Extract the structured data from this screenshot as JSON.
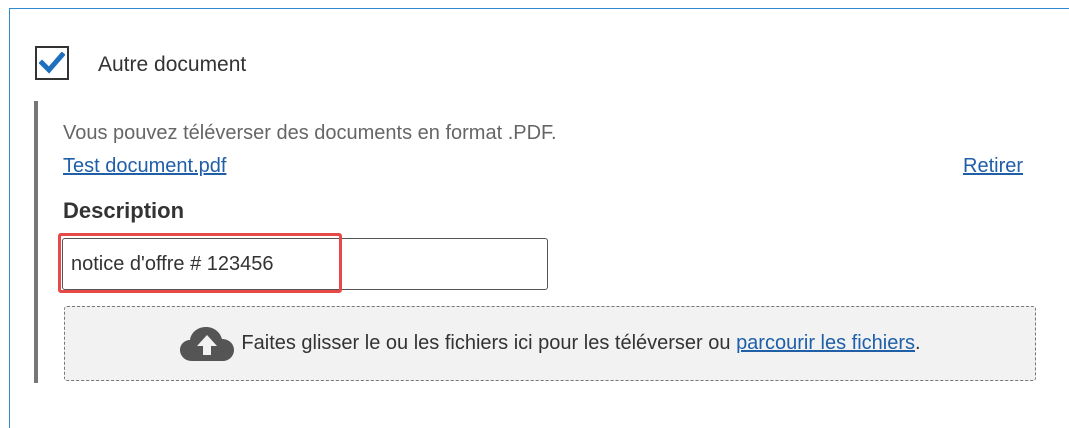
{
  "section": {
    "checkbox_checked": true,
    "checkbox_label": "Autre document",
    "hint": "Vous pouvez téléverser des documents en format .PDF.",
    "file_name": "Test document.pdf",
    "remove_label": "Retirer",
    "description_label": "Description",
    "description_value": "notice d'offre # 123456"
  },
  "dropzone": {
    "text_before": "Faites glisser le ou les fichiers ici pour les téléverser ou",
    "browse_link": "parcourir les fichiers",
    "text_after": ".",
    "icon": "cloud-upload-icon"
  },
  "colors": {
    "link": "#1f5fa8",
    "check": "#1f6fbf",
    "highlight": "#e74848",
    "panel_border": "#2e8bd1"
  }
}
